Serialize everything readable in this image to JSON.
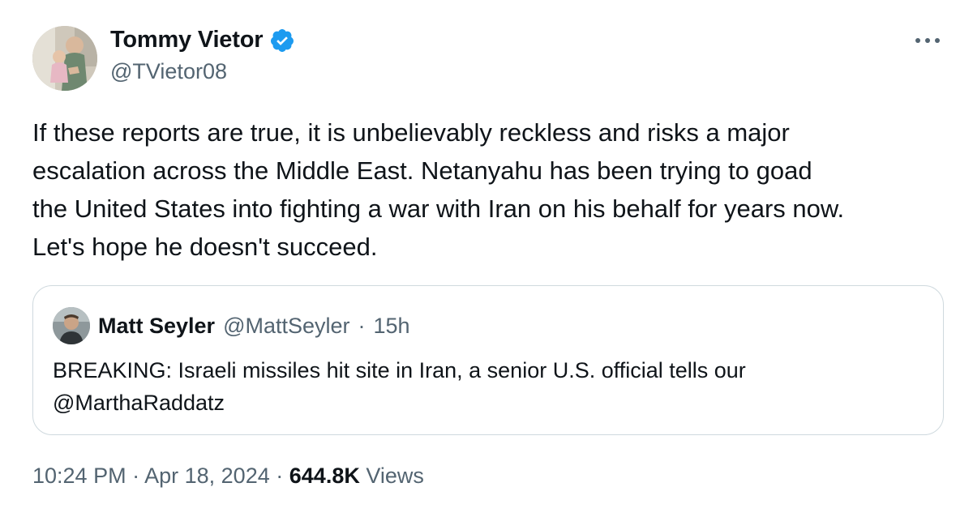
{
  "author": {
    "display_name": "Tommy Vietor",
    "handle": "@TVietor08",
    "verified": true,
    "avatar_icon": "profile-photo-person-holding-child"
  },
  "menu_icon": "more-horizontal-icon",
  "tweet": {
    "text": "If these reports are true, it is unbelievably reckless and risks a major\nescalation across the Middle East. Netanyahu has been trying to goad\nthe United States into fighting a war with Iran on his behalf for years now.\nLet's hope he doesn't succeed."
  },
  "quote": {
    "display_name": "Matt Seyler",
    "handle": "@MattSeyler",
    "separator": "·",
    "time": "15h",
    "text": "BREAKING: Israeli missiles hit site in Iran, a senior U.S. official tells our\n@MarthaRaddatz"
  },
  "meta": {
    "time": "10:24 PM",
    "sep1": "·",
    "date": "Apr 18, 2024",
    "sep2": "·",
    "views_count": "644.8K",
    "views_label": "Views"
  },
  "colors": {
    "text_primary": "#0f1419",
    "text_secondary": "#536471",
    "verified_blue": "#1d9bf0",
    "border": "#cfd9de"
  }
}
